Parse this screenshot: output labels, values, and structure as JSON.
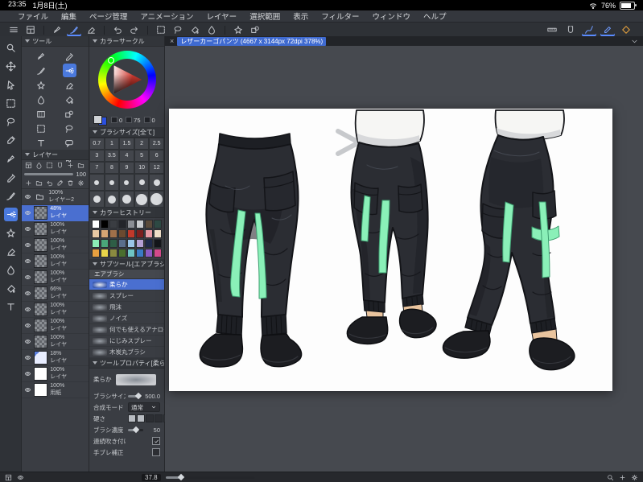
{
  "status_bar": {
    "time": "23:35",
    "date": "1月8日(土)",
    "battery_percent": "76%"
  },
  "menu_bar": {
    "items": [
      "ファイル",
      "編集",
      "ページ管理",
      "アニメーション",
      "レイヤー",
      "選択範囲",
      "表示",
      "フィルター",
      "ウィンドウ",
      "ヘルプ"
    ]
  },
  "command_bar": {
    "left_icons": [
      "hamburger",
      "layout",
      "|",
      "pen",
      "brush",
      "eraser",
      "|",
      "undo",
      "redo",
      "|",
      "marquee",
      "lasso",
      "fill",
      "blend",
      "|",
      "decoration",
      "figure"
    ],
    "active_left": [
      "brush"
    ],
    "right_icons": [
      "ruler",
      "snap",
      "draw",
      "edit",
      "diamond"
    ],
    "active_right": [
      "draw",
      "edit"
    ]
  },
  "document_tab": {
    "close": "×",
    "title": "レザーカーゴパンツ (4667 x 3144px 72dpi 378%)"
  },
  "tool_strip": {
    "tools": [
      "zoom",
      "move",
      "operate",
      "marquee",
      "lasso",
      "eyedropper",
      "pen",
      "pencil",
      "brush",
      "airbrush",
      "decoration",
      "eraser",
      "blend",
      "fill",
      "text"
    ],
    "active": "airbrush"
  },
  "tool_panel": {
    "title": "ツール",
    "tools": [
      "pen",
      "pencil",
      "brush",
      "airbrush",
      "decoration",
      "eraser",
      "blend",
      "fill",
      "gradient",
      "figure",
      "marquee",
      "lasso",
      "text",
      "balloon",
      "ruler",
      "operate"
    ],
    "active": "airbrush"
  },
  "layers_panel": {
    "title": "レイヤー",
    "opacity": "100",
    "top_icons": [
      "layout",
      "blend",
      "marquee",
      "snap",
      "plus",
      "folder"
    ],
    "bottom_icons": [
      "plus",
      "folder",
      "undo",
      "eyedropper",
      "trash",
      "gear"
    ],
    "rows": [
      {
        "pct": "100%",
        "name": "レイヤー2",
        "thumb": "folder",
        "selected": false
      },
      {
        "pct": "48%",
        "name": "レイヤ",
        "thumb": "checker",
        "selected": true
      },
      {
        "pct": "100%",
        "name": "レイヤ",
        "thumb": "checker",
        "selected": false
      },
      {
        "pct": "100%",
        "name": "レイヤ",
        "thumb": "checker",
        "selected": false
      },
      {
        "pct": "100%",
        "name": "レイヤ",
        "thumb": "checker",
        "selected": false
      },
      {
        "pct": "100%",
        "name": "レイヤ",
        "thumb": "checker",
        "selected": false
      },
      {
        "pct": "66%",
        "name": "レイヤ",
        "thumb": "checker",
        "selected": false
      },
      {
        "pct": "100%",
        "name": "レイヤ",
        "thumb": "checker",
        "selected": false
      },
      {
        "pct": "100%",
        "name": "レイヤ",
        "thumb": "checker",
        "selected": false
      },
      {
        "pct": "100%",
        "name": "レイヤ",
        "thumb": "checker",
        "selected": false
      },
      {
        "pct": "18%",
        "name": "レイヤ",
        "thumb": "blue",
        "selected": false
      },
      {
        "pct": "100%",
        "name": "レイヤ",
        "thumb": "white",
        "selected": false
      },
      {
        "pct": "100%",
        "name": "用紙",
        "thumb": "white",
        "selected": false
      }
    ]
  },
  "color_panel": {
    "title": "カラーサークル",
    "values": [
      "0",
      "75",
      "0"
    ]
  },
  "brush_size_panel": {
    "title": "ブラシサイズ[全て]",
    "sizes_text": [
      "0.7",
      "1",
      "1.5",
      "2",
      "2.5",
      "3",
      "3.5",
      "4",
      "5",
      "6",
      "7",
      "8",
      "9",
      "10",
      "12"
    ],
    "sizes_circle": [
      15,
      17,
      20,
      25,
      30,
      40,
      50,
      60,
      80,
      100
    ]
  },
  "color_history_panel": {
    "title": "カラーヒストリー",
    "colors": [
      "#ffffff",
      "#000000",
      "#3a3d42",
      "#23252a",
      "#8b8e94",
      "#c9cbce",
      "#5a4a3a",
      "#2e4a44",
      "#e8c9a4",
      "#d4a574",
      "#a0704a",
      "#6b4a30",
      "#c0392b",
      "#7a1f1f",
      "#e89aa4",
      "#f0e0c8",
      "#8beeb6",
      "#4aa67a",
      "#2e5e46",
      "#5a6e8c",
      "#9ac4e8",
      "#b4a0d4",
      "#1f2a4a",
      "#14161a",
      "#e8a040",
      "#e8d44a",
      "#8a8a40",
      "#4a6e2e",
      "#6ec4c4",
      "#3a7ac4",
      "#8c5ac4",
      "#d44a8c"
    ]
  },
  "subtool_panel": {
    "title": "サブツール[エアブラシ]",
    "group": "エアブラシ",
    "items": [
      "柔らか",
      "スプレー",
      "飛沫",
      "ノイズ",
      "何でも使えるアナログ風ブラシ",
      "にじみスプレー",
      "木炭丸ブラシ"
    ],
    "selected_index": 0
  },
  "tool_property_panel": {
    "title": "ツールプロパティ[柔らか]",
    "preset": "柔らか",
    "properties": [
      {
        "label": "ブラシサイズ",
        "value": "500.0",
        "type": "slider",
        "percent": 70
      },
      {
        "label": "合成モード",
        "value": "通常",
        "type": "dropdown"
      },
      {
        "label": "硬さ",
        "value": "",
        "type": "blocks",
        "on": 2
      },
      {
        "label": "ブラシ濃度",
        "value": "50",
        "type": "slider",
        "percent": 50
      },
      {
        "label": "連続吹き付け",
        "value": "",
        "type": "checkbox",
        "checked": true
      },
      {
        "label": "手ブレ補正",
        "value": "",
        "type": "checkbox",
        "checked": false
      }
    ]
  },
  "navigator_bar": {
    "zoom": "37.8",
    "left_icons": [
      "layout",
      "eye"
    ],
    "right_icons": [
      "zoom",
      "plus",
      "gear"
    ]
  },
  "theme": {
    "accent_blue": "#4a6fd0",
    "strap_mint": "#8af0b8",
    "canvas_bg": "#ffffff"
  }
}
